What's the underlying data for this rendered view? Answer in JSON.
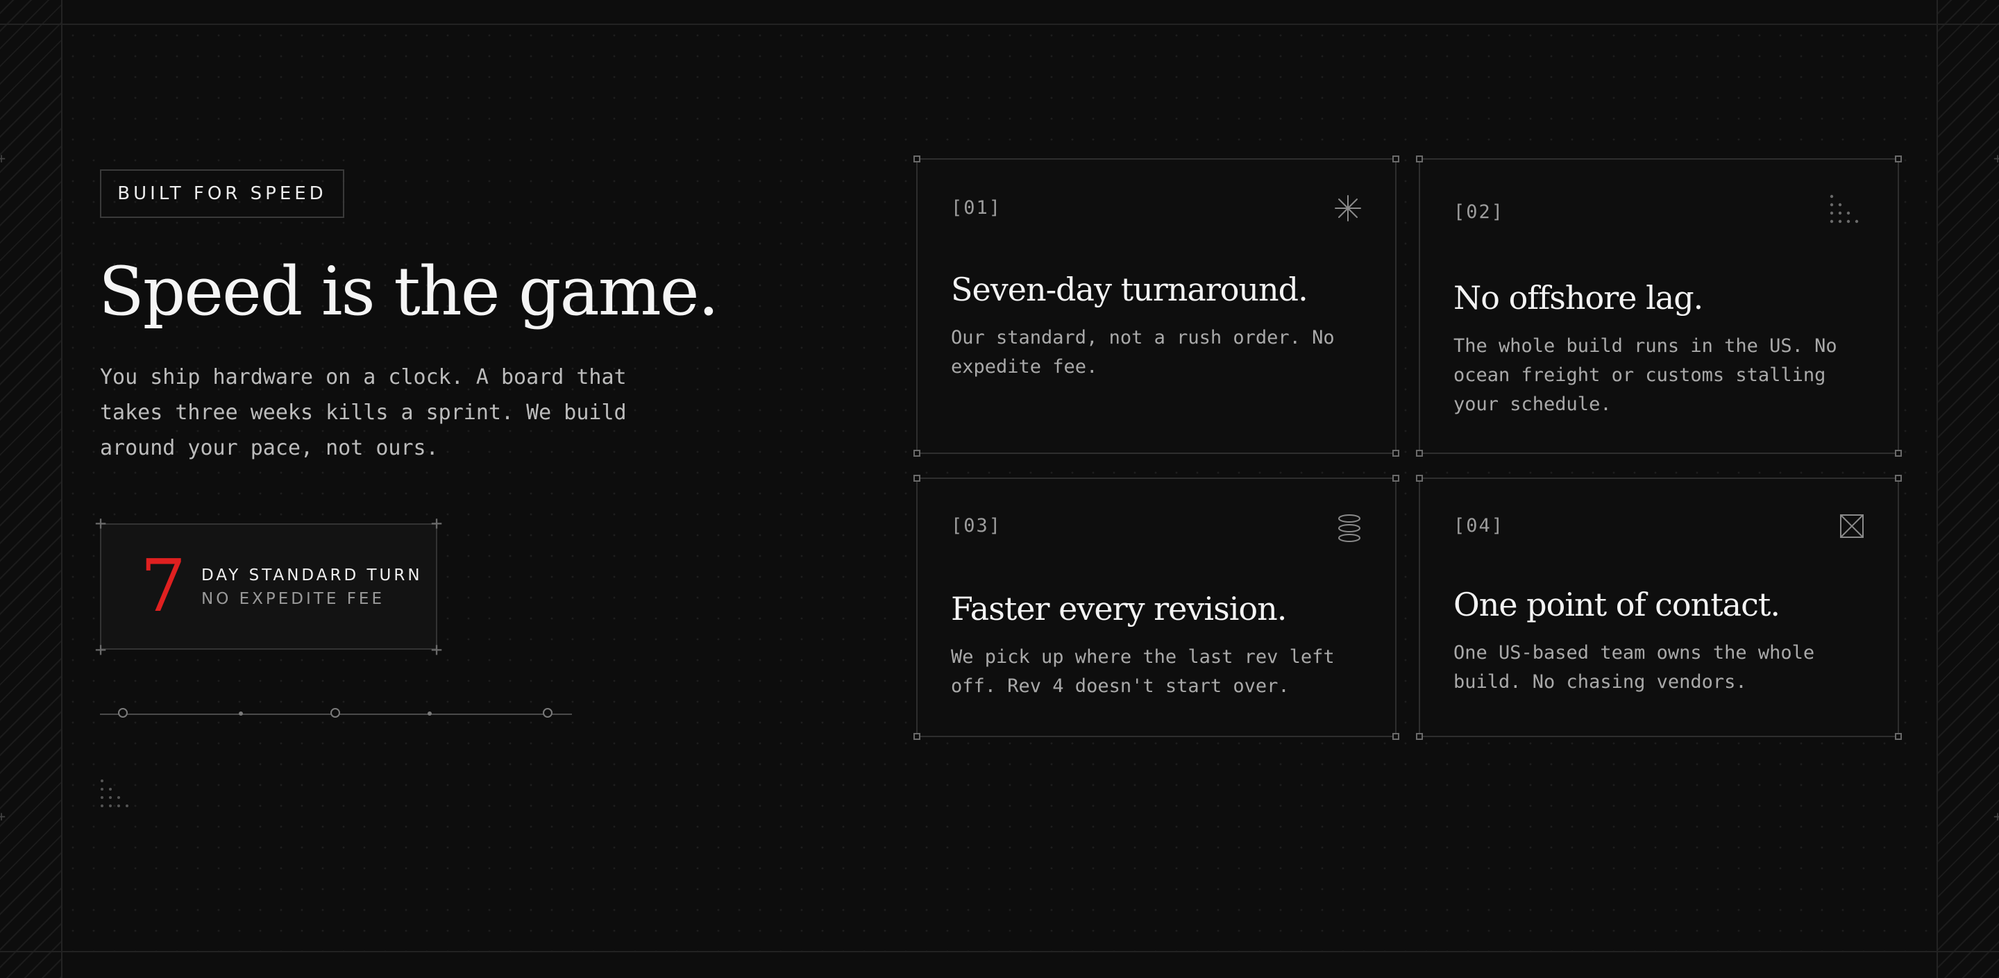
{
  "hero": {
    "badge": "BUILT FOR SPEED",
    "headline": "Speed is the game.",
    "intro": "You ship hardware on a clock. A board that takes three weeks kills a sprint. We build around your pace, not ours."
  },
  "stat": {
    "number": "7",
    "label": "DAY STANDARD TURN",
    "sublabel": "NO EXPEDITE FEE"
  },
  "colors": {
    "accent": "#e02020",
    "background": "#0d0d0d",
    "card_border": "#2e2e2e"
  },
  "cards": [
    {
      "index": "[01]",
      "icon": "asterisk-icon",
      "title": "Seven-day turnaround.",
      "body": "Our standard, not a rush order. No expedite fee."
    },
    {
      "index": "[02]",
      "icon": "dot-grid-icon",
      "title": "No offshore lag.",
      "body": "The whole build runs in the US. No ocean freight or customs stalling your schedule."
    },
    {
      "index": "[03]",
      "icon": "layers-icon",
      "title": "Faster every revision.",
      "body": "We pick up where the last rev left off. Rev 4 doesn't start over."
    },
    {
      "index": "[04]",
      "icon": "crossed-box-icon",
      "title": "One point of contact.",
      "body": "One US-based team owns the whole build. No chasing vendors."
    }
  ]
}
